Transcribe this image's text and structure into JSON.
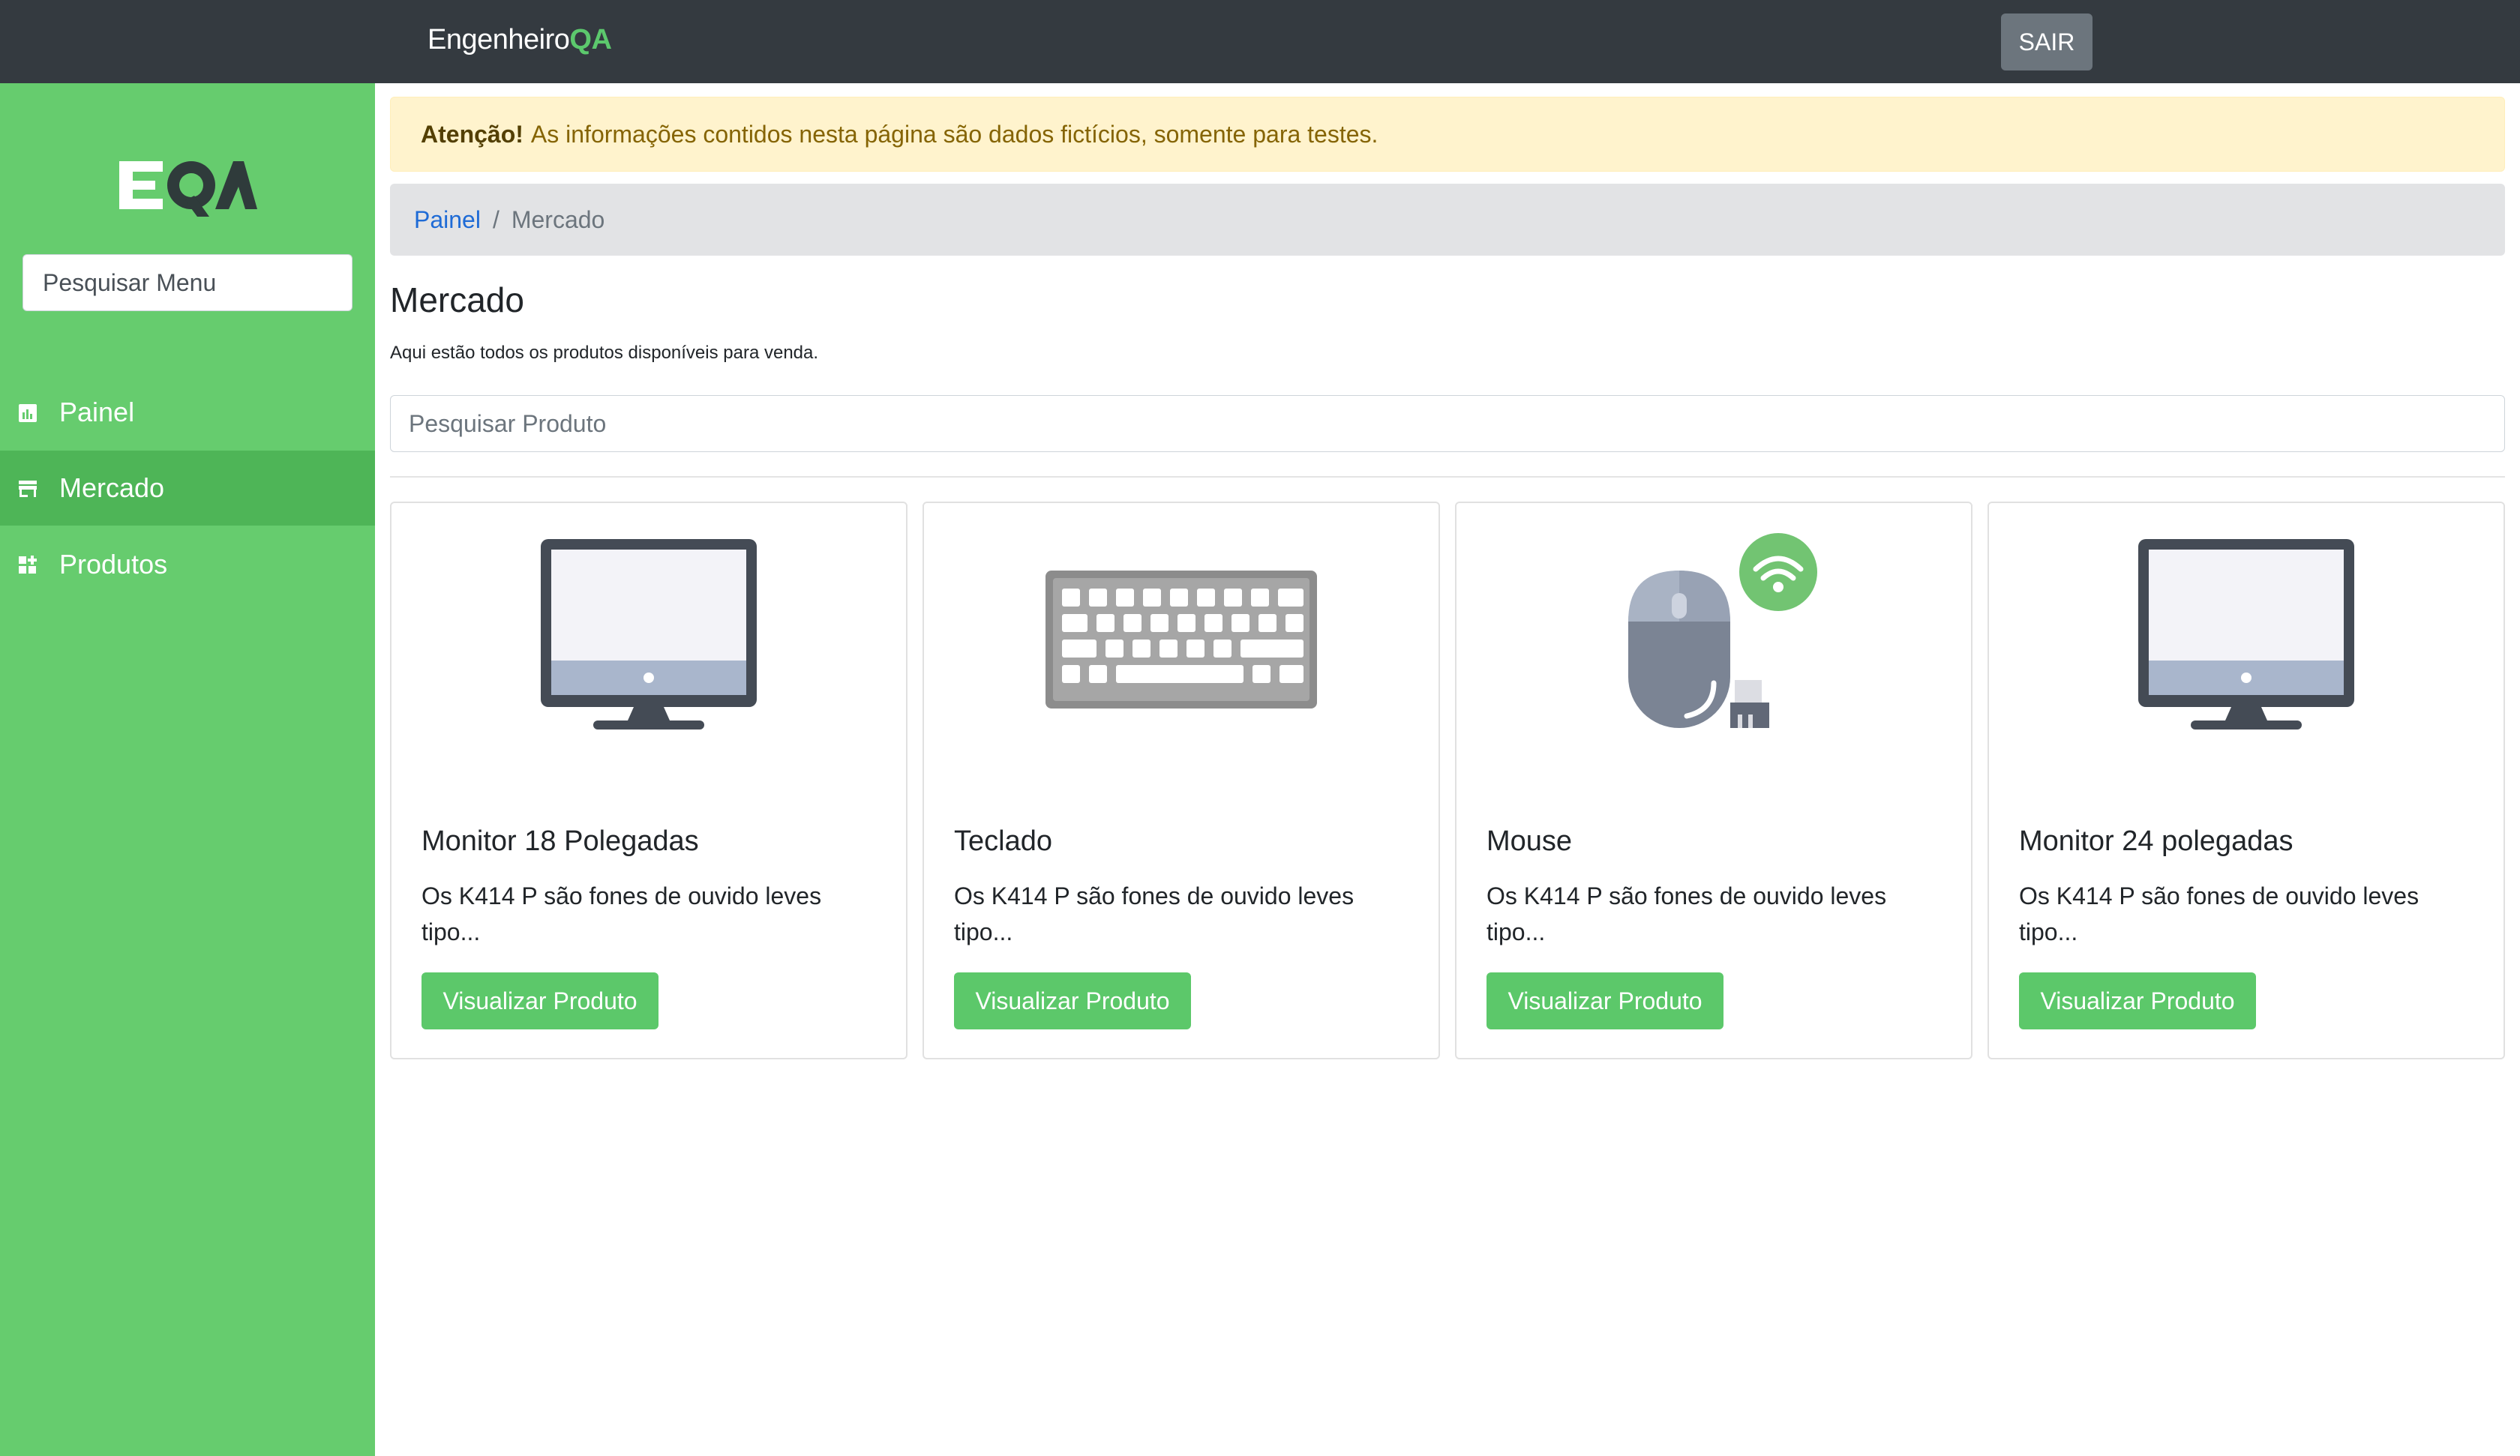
{
  "header": {
    "brand_main": "Engenheiro",
    "brand_accent": "QA",
    "logout_label": "SAIR"
  },
  "sidebar": {
    "logo_text": "EQA",
    "search_placeholder": "Pesquisar Menu",
    "items": [
      {
        "label": "Painel",
        "icon": "chart-icon",
        "active": false
      },
      {
        "label": "Mercado",
        "icon": "store-icon",
        "active": true
      },
      {
        "label": "Produtos",
        "icon": "grid-plus-icon",
        "active": false
      }
    ]
  },
  "alert": {
    "strong": "Atenção!",
    "text": "As informações contidos nesta página são dados fictícios, somente para testes."
  },
  "breadcrumb": {
    "link": "Painel",
    "separator": "/",
    "current": "Mercado"
  },
  "page": {
    "title": "Mercado",
    "subtitle": "Aqui estão todos os produtos disponíveis para venda.",
    "search_placeholder": "Pesquisar Produto"
  },
  "products": [
    {
      "title": "Monitor 18 Polegadas",
      "description": "Os K414 P são fones de ouvido leves tipo...",
      "button": "Visualizar Produto",
      "image": "monitor-icon"
    },
    {
      "title": "Teclado",
      "description": "Os K414 P são fones de ouvido leves tipo...",
      "button": "Visualizar Produto",
      "image": "keyboard-icon"
    },
    {
      "title": "Mouse",
      "description": "Os K414 P são fones de ouvido leves tipo...",
      "button": "Visualizar Produto",
      "image": "wireless-mouse-icon"
    },
    {
      "title": "Monitor 24 polegadas",
      "description": "Os K414 P são fones de ouvido leves tipo...",
      "button": "Visualizar Produto",
      "image": "monitor-icon"
    }
  ],
  "colors": {
    "topbar": "#343a40",
    "sidebar": "#66cc6e",
    "sidebar_active": "#4eb557",
    "accent": "#5cc86a",
    "alert_bg": "#fff3cd"
  }
}
